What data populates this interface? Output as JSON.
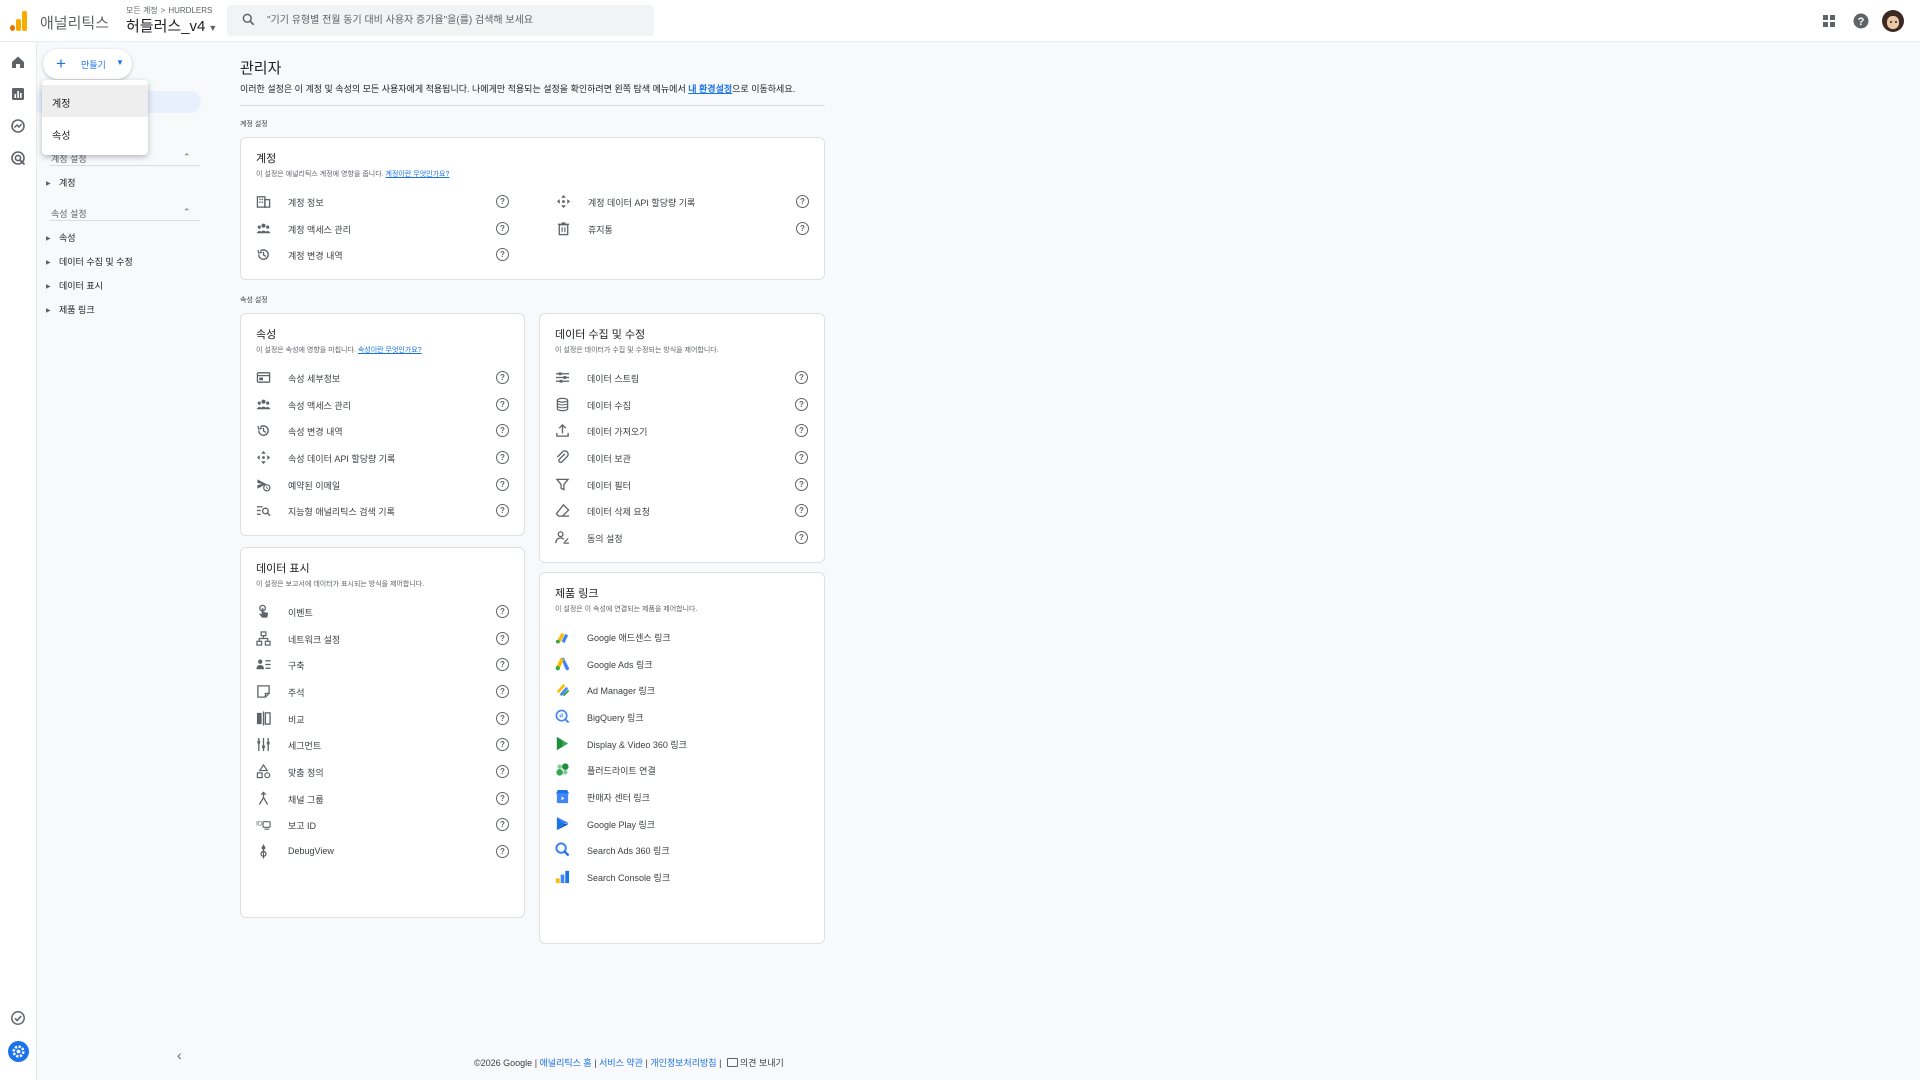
{
  "topbar": {
    "app_name": "애널리틱스",
    "breadcrumb_all": "모든 계정",
    "breadcrumb_account": "HURDLERS",
    "property_name": "허들러스_v4",
    "search_placeholder": "\"기기 유형별 전월 동기 대비 사용자 증가율\"을(를) 검색해 보세요"
  },
  "sidenav": {
    "create_label": "만들기",
    "sections": [
      {
        "title": "계정 설정",
        "items": [
          "계정"
        ]
      },
      {
        "title": "속성 설정",
        "items": [
          "속성",
          "데이터 수집 및 수정",
          "데이터 표시",
          "제품 링크"
        ]
      }
    ]
  },
  "create_menu": {
    "items": [
      "계정",
      "속성"
    ]
  },
  "main": {
    "title": "관리자",
    "description_pre": "이러한 설정은 이 계정 및 속성의 모든 사용자에게 적용됩니다. 나에게만 적용되는 설정을 확인하려면 왼쪽 탐색 메뉴에서 ",
    "description_link": "내 환경설정",
    "description_post": "으로 이동하세요.",
    "account_group_label": "계정 설정",
    "property_group_label": "속성 설정",
    "account_card": {
      "title": "계정",
      "desc": "이 설정은 애널리틱스 계정에 영향을 줍니다.",
      "desc_link": "계정이란 무엇인가요?",
      "left": [
        "계정 정보",
        "계정 액세스 관리",
        "계정 변경 내역"
      ],
      "right": [
        "계정 데이터 API 할당량 기록",
        "휴지통"
      ]
    },
    "property_card": {
      "title": "속성",
      "desc": "이 설정은 속성에 영향을 미칩니다.",
      "desc_link": "속성이란 무엇인가요?",
      "items": [
        "속성 세부정보",
        "속성 액세스 관리",
        "속성 변경 내역",
        "속성 데이터 API 할당량 기록",
        "예약된 이메일",
        "지능형 애널리틱스 검색 기록"
      ]
    },
    "collection_card": {
      "title": "데이터 수집 및 수정",
      "desc": "이 설정은 데이터가 수집 및 수정되는 방식을 제어합니다.",
      "items": [
        "데이터 스트림",
        "데이터 수집",
        "데이터 가져오기",
        "데이터 보관",
        "데이터 필터",
        "데이터 삭제 요청",
        "동의 설정"
      ]
    },
    "display_card": {
      "title": "데이터 표시",
      "desc": "이 설정은 보고서에 데이터가 표시되는 방식을 제어합니다.",
      "items": [
        "이벤트",
        "네트워크 설정",
        "구축",
        "주석",
        "비교",
        "세그먼트",
        "맞춤 정의",
        "채널 그룹",
        "보고 ID",
        "DebugView"
      ]
    },
    "links_card": {
      "title": "제품 링크",
      "desc": "이 설정은 이 속성에 연결되는 제품을 제어합니다.",
      "items": [
        "Google 애드센스 링크",
        "Google Ads 링크",
        "Ad Manager 링크",
        "BigQuery 링크",
        "Display & Video 360 링크",
        "플러드라이트 연결",
        "판매자 센터 링크",
        "Google Play 링크",
        "Search Ads 360 링크",
        "Search Console 링크"
      ]
    }
  },
  "footer": {
    "copyright": "©2026 Google",
    "links": [
      "애널리틱스 홈",
      "서비스 약관",
      "개인정보처리방침"
    ],
    "feedback": "의견 보내기"
  },
  "colors": {
    "accent": "#1a73e8",
    "logo_orange": "#f9ab00",
    "logo_dark": "#e37400",
    "settings_blue": "#1a73e8"
  }
}
